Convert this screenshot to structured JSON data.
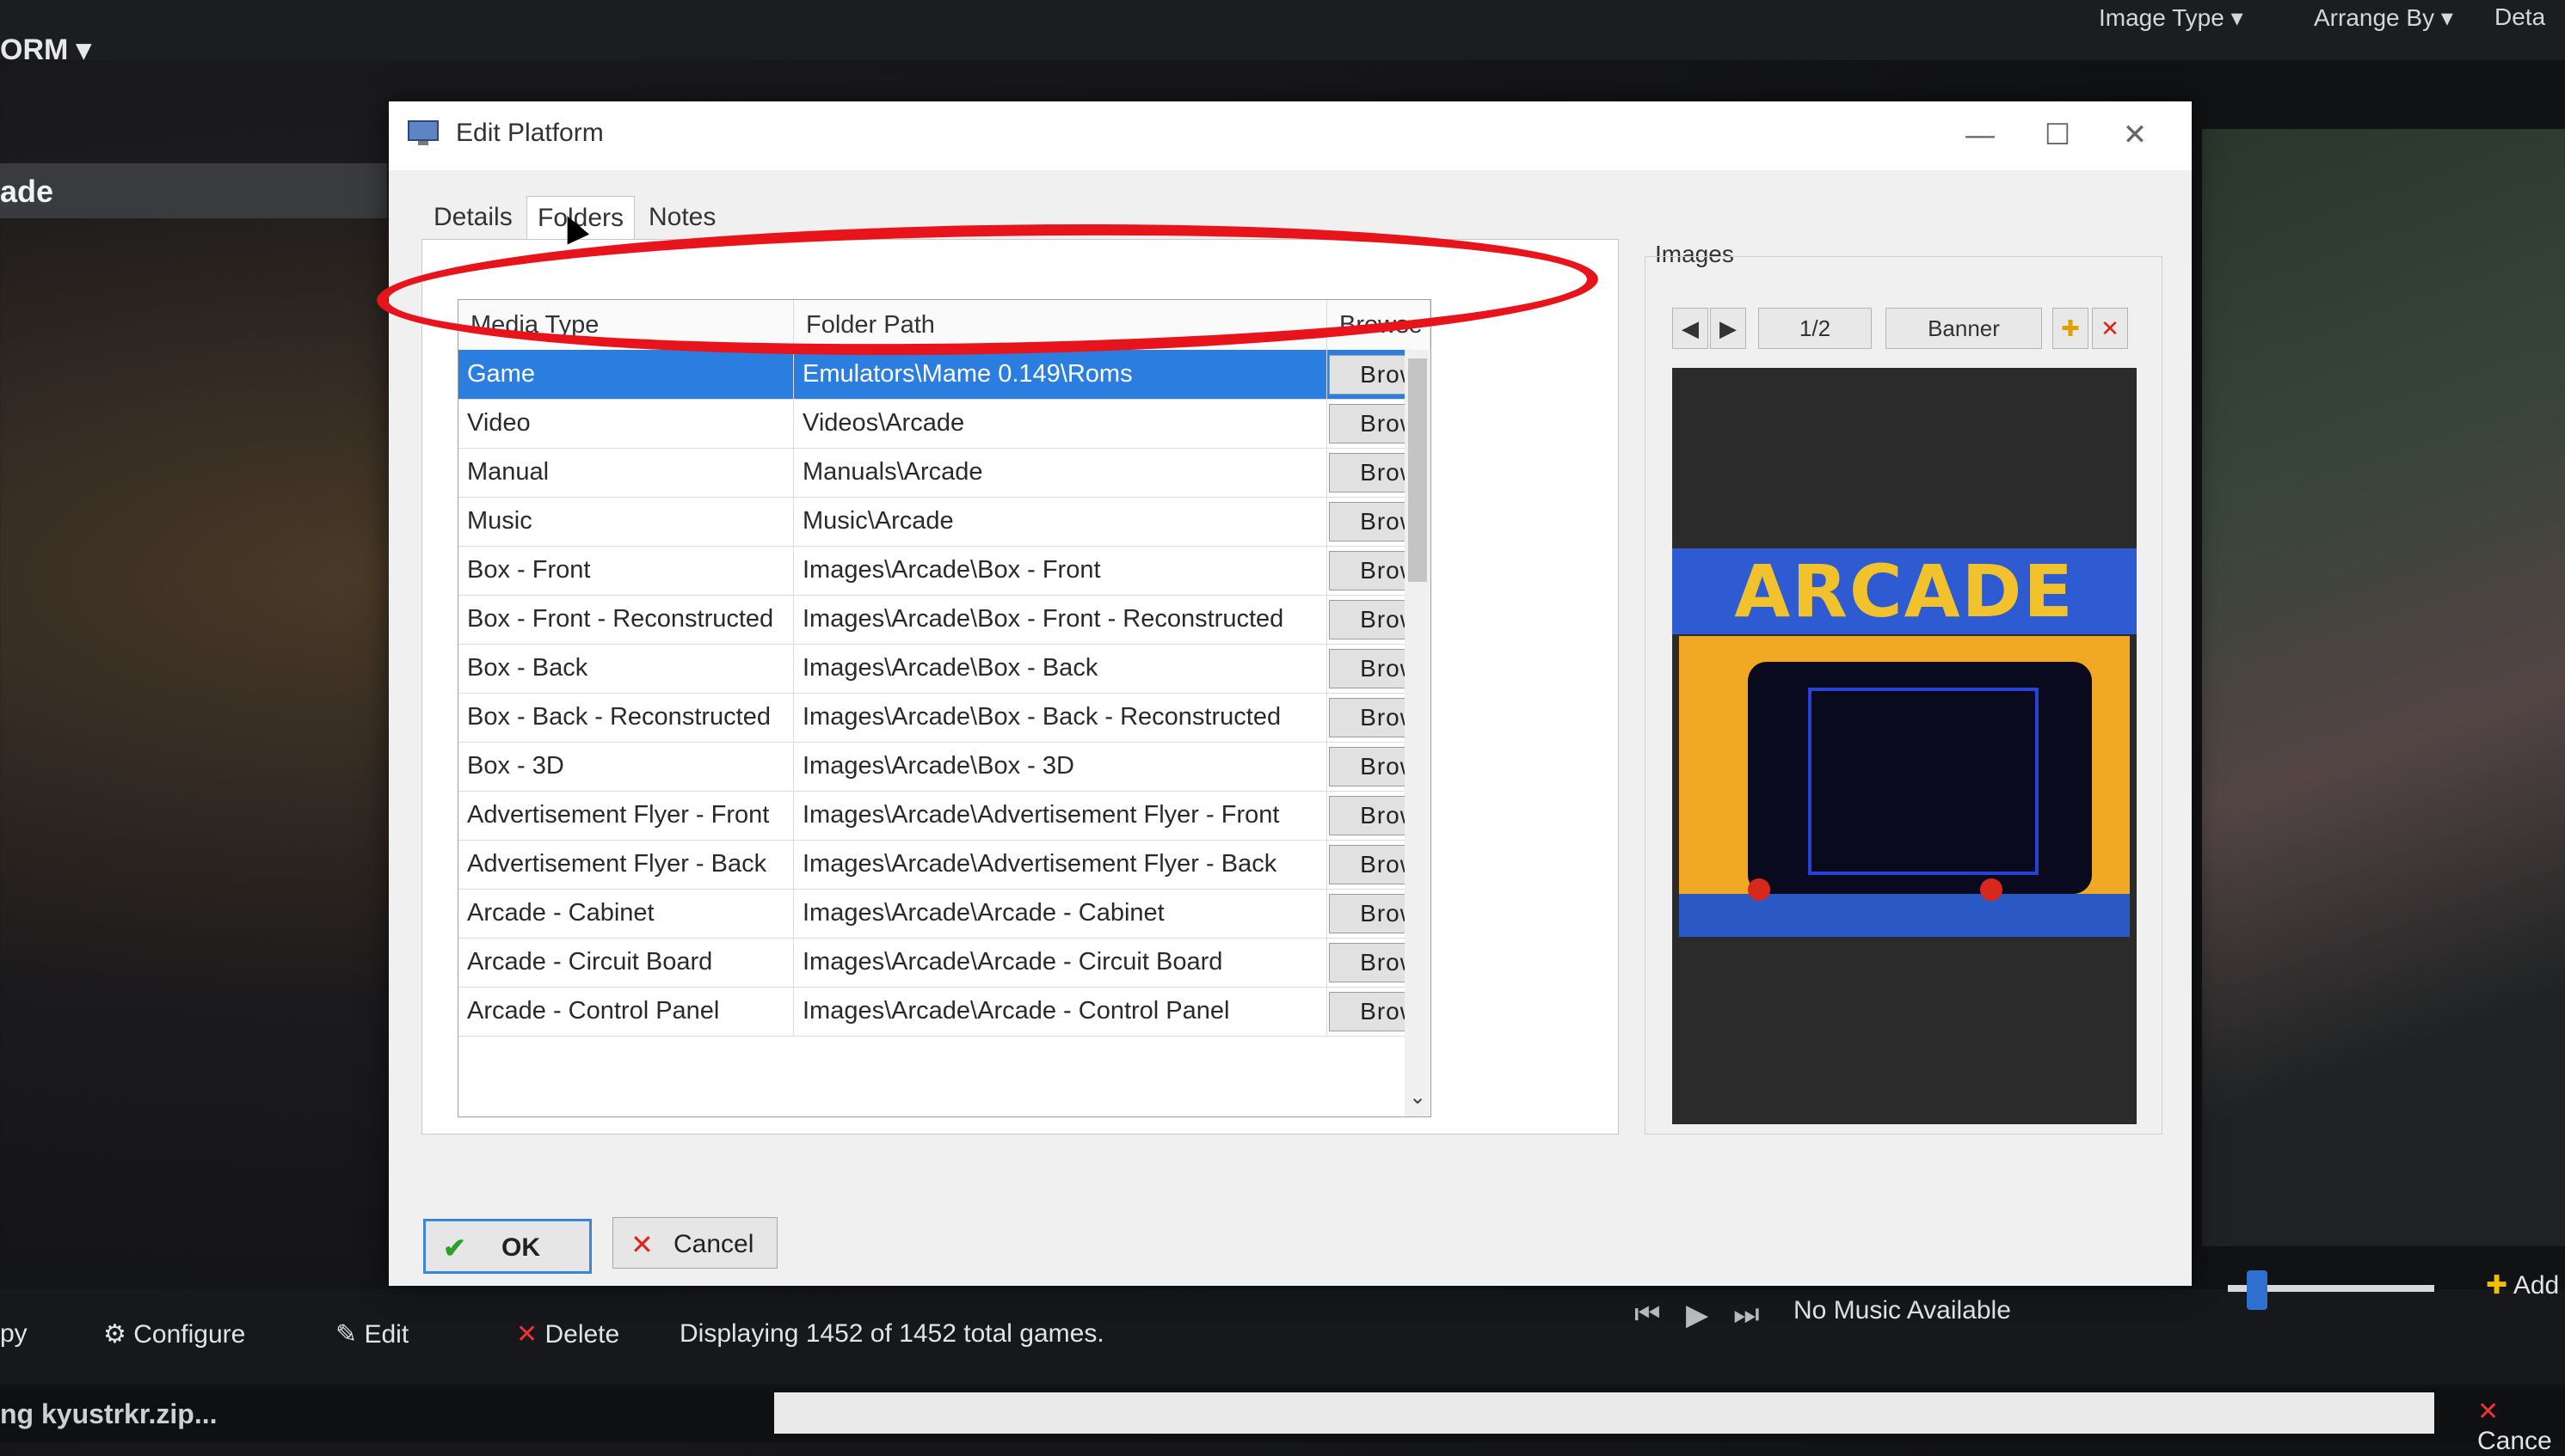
{
  "background_app": {
    "top_menu": [
      "Image Type",
      "Arrange By",
      "Deta"
    ],
    "left_title": "ORM ▾",
    "left_selected": "ade",
    "bottom": {
      "items": [
        "Configure",
        "Edit",
        "Delete"
      ],
      "left_cut": "py",
      "status": "Displaying 1452 of 1452 total games.",
      "music": "No Music Available",
      "add_label": "Add",
      "cancel_label": "Cance"
    },
    "download_status": "ng kyustrkr.zip..."
  },
  "dialog": {
    "title": "Edit Platform",
    "tabs": [
      {
        "label": "Details"
      },
      {
        "label": "Folders"
      },
      {
        "label": "Notes"
      }
    ],
    "grid": {
      "headers": {
        "media_type": "Media Type",
        "folder_path": "Folder Path",
        "browse": "Browse"
      },
      "browse_label": "Browse...",
      "rows": [
        {
          "media_type": "Game",
          "folder_path": "Emulators\\Mame 0.149\\Roms"
        },
        {
          "media_type": "Video",
          "folder_path": "Videos\\Arcade"
        },
        {
          "media_type": "Manual",
          "folder_path": "Manuals\\Arcade"
        },
        {
          "media_type": "Music",
          "folder_path": "Music\\Arcade"
        },
        {
          "media_type": "Box - Front",
          "folder_path": "Images\\Arcade\\Box - Front"
        },
        {
          "media_type": "Box - Front - Reconstructed",
          "folder_path": "Images\\Arcade\\Box - Front - Reconstructed"
        },
        {
          "media_type": "Box - Back",
          "folder_path": "Images\\Arcade\\Box - Back"
        },
        {
          "media_type": "Box - Back - Reconstructed",
          "folder_path": "Images\\Arcade\\Box - Back - Reconstructed"
        },
        {
          "media_type": "Box - 3D",
          "folder_path": "Images\\Arcade\\Box - 3D"
        },
        {
          "media_type": "Advertisement Flyer - Front",
          "folder_path": "Images\\Arcade\\Advertisement Flyer - Front"
        },
        {
          "media_type": "Advertisement Flyer - Back",
          "folder_path": "Images\\Arcade\\Advertisement Flyer - Back"
        },
        {
          "media_type": "Arcade - Cabinet",
          "folder_path": "Images\\Arcade\\Arcade - Cabinet"
        },
        {
          "media_type": "Arcade - Circuit Board",
          "folder_path": "Images\\Arcade\\Arcade - Circuit Board"
        },
        {
          "media_type": "Arcade - Control Panel",
          "folder_path": "Images\\Arcade\\Arcade - Control Panel"
        }
      ]
    },
    "images": {
      "label": "Images",
      "counter": "1/2",
      "type": "Banner",
      "banner_text": "ARCADE"
    },
    "buttons": {
      "ok": "OK",
      "cancel": "Cancel"
    },
    "colors": {
      "selection": "#2c7de0",
      "highlight_circle": "#e8141c",
      "banner": "#2e5bd1"
    }
  }
}
